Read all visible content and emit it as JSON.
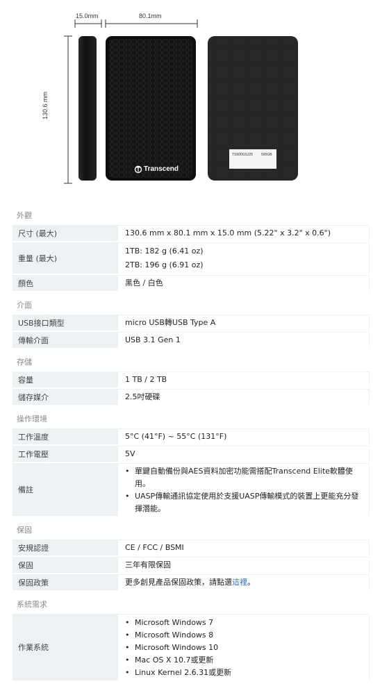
{
  "dimensions": {
    "depth": "15.0mm",
    "width": "80.1mm",
    "height": "130.6 mm"
  },
  "product": {
    "brand": "Transcend",
    "label_lines": [
      "TS500GSJ25",
      "500GB"
    ]
  },
  "sections": [
    {
      "title": "外觀",
      "rows": [
        {
          "label": "尺寸 (最大)",
          "lines": [
            "130.6 mm x 80.1 mm x 15.0 mm (5.22\" x 3.2\" x 0.6\")"
          ]
        },
        {
          "label": "重量 (最大)",
          "lines": [
            "1TB: 182 g (6.41 oz)",
            "2TB: 196 g (6.91 oz)"
          ]
        },
        {
          "label": "顏色",
          "lines": [
            "黑色 / 白色"
          ]
        }
      ]
    },
    {
      "title": "介面",
      "rows": [
        {
          "label": "USB接口類型",
          "lines": [
            "micro USB轉USB Type A"
          ]
        },
        {
          "label": "傳輸介面",
          "lines": [
            "USB 3.1 Gen 1"
          ]
        }
      ]
    },
    {
      "title": "存儲",
      "rows": [
        {
          "label": "容量",
          "lines": [
            "1 TB / 2 TB"
          ]
        },
        {
          "label": "儲存媒介",
          "lines": [
            "2.5吋硬碟"
          ]
        }
      ]
    },
    {
      "title": "操作環境",
      "rows": [
        {
          "label": "工作溫度",
          "lines": [
            "5°C (41°F) ~ 55°C (131°F)"
          ]
        },
        {
          "label": "工作電壓",
          "lines": [
            "5V"
          ]
        },
        {
          "label": "備註",
          "bullets": [
            "單鍵自動備份與AES資料加密功能需搭配Transcend Elite軟體使用。",
            "UASP傳輸通訊協定使用於支援UASP傳輸模式的裝置上更能充分發揮潛能。"
          ]
        }
      ]
    },
    {
      "title": "保固",
      "rows": [
        {
          "label": "安規認證",
          "lines": [
            "CE / FCC / BSMI"
          ]
        },
        {
          "label": "保固",
          "lines": [
            "三年有限保固"
          ]
        },
        {
          "label": "保固政策",
          "warranty_text": "更多創見產品保固政策，請點選",
          "warranty_link": "這裡",
          "warranty_end": "。"
        }
      ]
    },
    {
      "title": "系統需求",
      "rows": [
        {
          "label": "作業系統",
          "bullets": [
            "Microsoft Windows 7",
            "Microsoft Windows 8",
            "Microsoft Windows 10",
            "Mac OS X 10.7或更新",
            "Linux Kernel 2.6.31或更新"
          ]
        }
      ]
    }
  ]
}
